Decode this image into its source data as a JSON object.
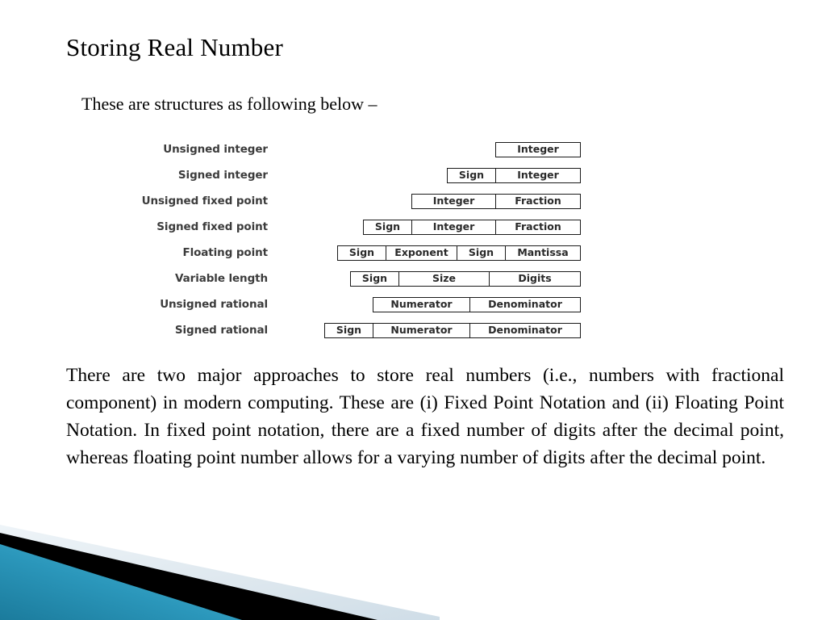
{
  "slide": {
    "title": "Storing Real Number",
    "intro": "These are structures as following below –"
  },
  "diagram": {
    "name": "real-number-storage-structures",
    "rows": [
      {
        "label": "Unsigned integer",
        "fields": [
          {
            "text": "Integer",
            "width": "w-integer"
          }
        ]
      },
      {
        "label": "Signed integer",
        "fields": [
          {
            "text": "Sign",
            "width": "w-sign"
          },
          {
            "text": "Integer",
            "width": "w-integer"
          }
        ]
      },
      {
        "label": "Unsigned fixed point",
        "fields": [
          {
            "text": "Integer",
            "width": "w-integer"
          },
          {
            "text": "Fraction",
            "width": "w-fraction"
          }
        ]
      },
      {
        "label": "Signed fixed point",
        "fields": [
          {
            "text": "Sign",
            "width": "w-sign"
          },
          {
            "text": "Integer",
            "width": "w-integer"
          },
          {
            "text": "Fraction",
            "width": "w-fraction"
          }
        ]
      },
      {
        "label": "Floating point",
        "fields": [
          {
            "text": "Sign",
            "width": "w-sign"
          },
          {
            "text": "Exponent",
            "width": "w-exponent"
          },
          {
            "text": "Sign",
            "width": "w-sign"
          },
          {
            "text": "Mantissa",
            "width": "w-mantissa"
          }
        ]
      },
      {
        "label": "Variable length",
        "fields": [
          {
            "text": "Sign",
            "width": "w-sign"
          },
          {
            "text": "Size",
            "width": "w-size"
          },
          {
            "text": "Digits",
            "width": "w-digits"
          }
        ]
      },
      {
        "label": "Unsigned rational",
        "fields": [
          {
            "text": "Numerator",
            "width": "w-numer"
          },
          {
            "text": "Denominator",
            "width": "w-denom"
          }
        ]
      },
      {
        "label": "Signed rational",
        "fields": [
          {
            "text": "Sign",
            "width": "w-sign"
          },
          {
            "text": "Numerator",
            "width": "w-numer"
          },
          {
            "text": "Denominator",
            "width": "w-denom"
          }
        ]
      }
    ]
  },
  "body": {
    "paragraph": "There are two major approaches to store real numbers (i.e., numbers with fractional component) in modern computing. These are (i) Fixed Point Notation and (ii) Floating Point Notation. In fixed point notation, there are a fixed number of digits after the decimal point, whereas floating point number allows for a varying number of digits after the decimal point."
  },
  "footer": {
    "name": "decorative-corner-graphic",
    "colors": {
      "teal_dark": "#1b7b9c",
      "teal_mid": "#2b97bb",
      "teal_light": "#55b9d6",
      "black_stripe": "#000000",
      "pale_band": "#dde7ee",
      "pale_band_edge": "#eef4f8"
    }
  }
}
